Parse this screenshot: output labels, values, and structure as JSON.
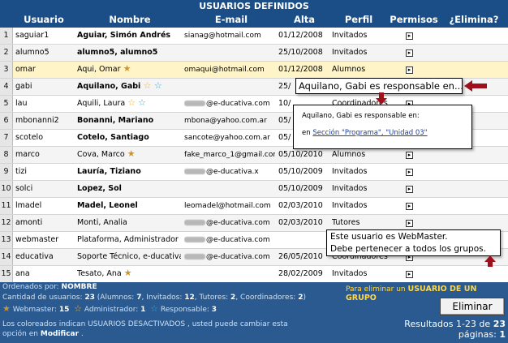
{
  "title": "USUARIOS DEFINIDOS",
  "columns": {
    "usuario": "Usuario",
    "nombre": "Nombre",
    "email": "E-mail",
    "alta": "Alta",
    "perfil": "Perfil",
    "permisos": "Permisos",
    "elimina": "¿Elimina?"
  },
  "rows": [
    {
      "n": "1",
      "user": "saguiar1",
      "name": "Aguiar, Simón Andrés",
      "bold": true,
      "email_prefix": "",
      "email": "sianag@hotmail.com",
      "alta": "01/12/2008",
      "perfil": "Invitados",
      "stars": [],
      "elim": "checkbox"
    },
    {
      "n": "2",
      "user": "alumno5",
      "name": "alumno5, alumno5",
      "bold": true,
      "email_prefix": "",
      "email": "",
      "alta": "25/10/2008",
      "perfil": "Invitados",
      "stars": [],
      "elim": "checkbox"
    },
    {
      "n": "3",
      "user": "omar",
      "name": "Aqui, Omar",
      "bold": false,
      "email_prefix": "",
      "email": "omaqui@hotmail.com",
      "alta": "01/12/2008",
      "perfil": "Alumnos",
      "stars": [
        "w"
      ],
      "elim": "inadmisible"
    },
    {
      "n": "4",
      "user": "gabi",
      "name": "Aquilano, Gabi",
      "bold": true,
      "email_prefix": "",
      "email": "",
      "alta": "25/",
      "perfil": "",
      "stars": [
        "a",
        "r"
      ],
      "elim": "badge"
    },
    {
      "n": "5",
      "user": "lau",
      "name": "Aquili, Laura",
      "bold": false,
      "email_prefix": "blur",
      "email": "@e-ducativa.com",
      "alta": "10/",
      "perfil": "Coordinadores",
      "stars": [
        "a",
        "r"
      ],
      "elim": "inadmisible"
    },
    {
      "n": "6",
      "user": "mbonanni2",
      "name": "Bonanni, Mariano",
      "bold": true,
      "email_prefix": "",
      "email": "mbona@yahoo.com.ar",
      "alta": "05/",
      "perfil": "",
      "stars": [],
      "elim": ""
    },
    {
      "n": "7",
      "user": "scotelo",
      "name": "Cotelo, Santiago",
      "bold": true,
      "email_prefix": "",
      "email": "sancote@yahoo.com.ar",
      "alta": "05/",
      "perfil": "",
      "stars": [],
      "elim": ""
    },
    {
      "n": "8",
      "user": "marco",
      "name": "Cova, Marco",
      "bold": false,
      "email_prefix": "",
      "email": "fake_marco_1@gmail.com",
      "alta": "05/10/2010",
      "perfil": "Alumnos",
      "stars": [
        "w"
      ],
      "elim": "inadmisible"
    },
    {
      "n": "9",
      "user": "tizi",
      "name": "Lauría, Tiziano",
      "bold": true,
      "email_prefix": "blur",
      "email": "@e-ducativa.x",
      "alta": "05/10/2009",
      "perfil": "Invitados",
      "stars": [],
      "elim": "checkbox"
    },
    {
      "n": "10",
      "user": "solci",
      "name": "Lopez, Sol",
      "bold": true,
      "email_prefix": "",
      "email": "",
      "alta": "05/10/2009",
      "perfil": "Invitados",
      "stars": [],
      "elim": "checkbox"
    },
    {
      "n": "11",
      "user": "lmadel",
      "name": "Madel, Leonel",
      "bold": true,
      "email_prefix": "",
      "email": "leomadel@hotmail.com",
      "alta": "02/03/2010",
      "perfil": "Invitados",
      "stars": [],
      "elim": "checkbox"
    },
    {
      "n": "12",
      "user": "amonti",
      "name": "Monti, Analia",
      "bold": false,
      "email_prefix": "blur",
      "email": "@e-ducativa.com",
      "alta": "02/03/2010",
      "perfil": "Tutores",
      "stars": [],
      "elim": "checkbox"
    },
    {
      "n": "13",
      "user": "webmaster",
      "name": "Plataforma, Administrador",
      "bold": false,
      "email_prefix": "blur",
      "email": "@e-ducativa.com",
      "alta": "",
      "perfil": "",
      "stars": [],
      "elim": "checkbox"
    },
    {
      "n": "14",
      "user": "educativa",
      "name": "Soporte Técnico, e-ducativa",
      "bold": false,
      "email_prefix": "blur",
      "email": "@e-ducativa.com",
      "alta": "26/05/2010",
      "perfil": "Coordinadores",
      "stars": [],
      "elim": ""
    },
    {
      "n": "15",
      "user": "ana",
      "name": "Tesato, Ana",
      "bold": false,
      "email_prefix": "",
      "email": "",
      "alta": "28/02/2009",
      "perfil": "Invitados",
      "stars": [
        "w"
      ],
      "elim": "inadmisible_badge"
    }
  ],
  "elim_inadmisible": "inadmisible",
  "footer": {
    "ordered_label": "Ordenados por:",
    "ordered_value": "NOMBRE",
    "count_label": "Cantidad de usuarios:",
    "count_total": "23",
    "alumnos_label": "Alumnos:",
    "alumnos": "7",
    "invitados_label": "Invitados:",
    "invitados": "12",
    "tutores_label": "Tutores:",
    "tutores": "2",
    "coord_label": "Coordinadores:",
    "coord": "2",
    "webmaster_label": "Webmaster:",
    "webmaster": "15",
    "admin_label": "Administrador:",
    "admin": "1",
    "resp_label": "Responsable:",
    "resp": "3",
    "note_a": "Los coloreados indican USUARIOS DESACTIVADOS , usted puede cambiar esta",
    "note_b": "opción en",
    "note_link": "Modificar",
    "note_end": ".",
    "hint_a": "Para eliminar un",
    "hint_b": "USUARIO DE UN GRUPO",
    "delete_button": "Eliminar",
    "results_label": "Resultados 1-23 de",
    "results_total": "23",
    "pages_label": "páginas:",
    "pages": "1"
  },
  "tooltips": {
    "tip1": "Aquilano, Gabi es responsable en...",
    "tip2_line1": "Aquilano, Gabi es responsable en:",
    "tip2_prefix": "en",
    "tip2_link": "Sección \"Programa\", \"Unidad 03\"",
    "tip3_line1": "Este usuario es WebMaster.",
    "tip3_line2": "Debe pertenecer a todos los grupos."
  },
  "colors": {
    "header_bg": "#1b4e86",
    "footer_bg": "#2a5a8f",
    "highlight_row": "#fff4c8",
    "arrow": "#a0101a"
  },
  "icons": {
    "webmaster_star": "webmaster-star-icon",
    "admin_star": "admin-star-icon",
    "responsible_star": "responsible-star-icon"
  }
}
